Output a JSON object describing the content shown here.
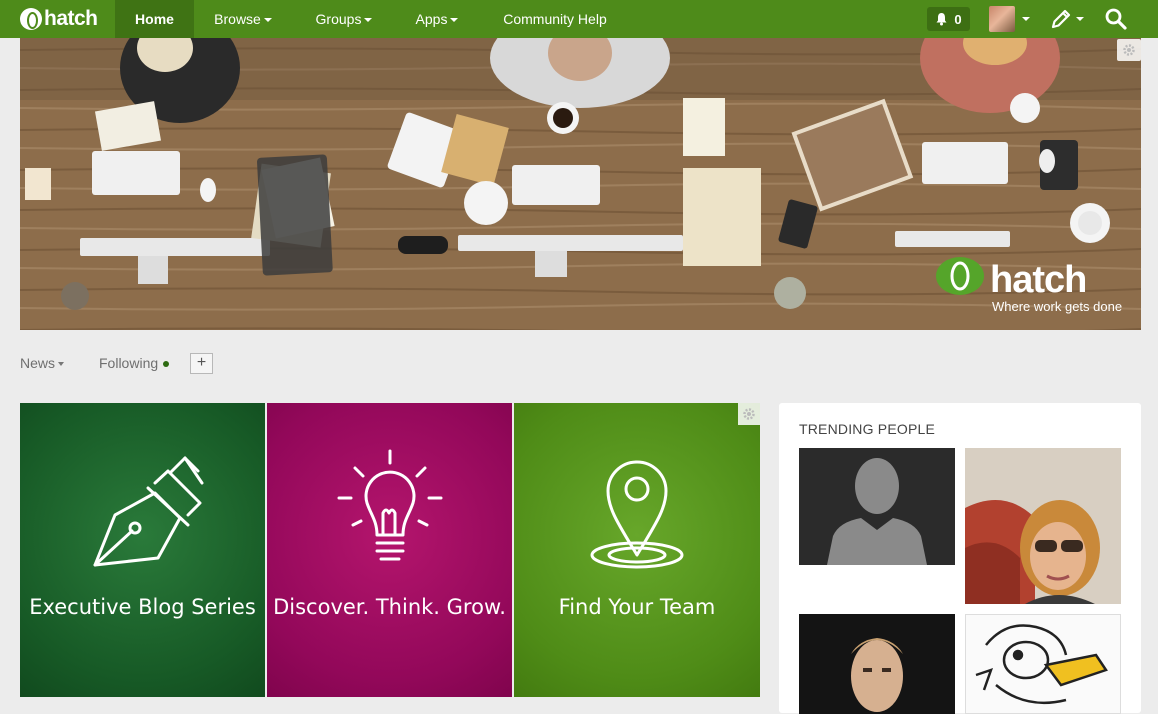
{
  "nav": {
    "logo_text": "hatch",
    "items": [
      {
        "label": "Home",
        "active": true
      },
      {
        "label": "Browse"
      },
      {
        "label": "Groups"
      },
      {
        "label": "Apps"
      },
      {
        "label": "Community Help"
      }
    ],
    "notification_count": "0",
    "icons": [
      "bell-icon",
      "avatar",
      "pencil-icon",
      "search-icon"
    ]
  },
  "banner": {
    "brand_word": "hatch",
    "brand_tagline": "Where work gets done"
  },
  "subtabs": {
    "news_label": "News",
    "following_label": "Following",
    "add_label": "+"
  },
  "tiles": [
    {
      "label": "Executive Blog Series",
      "icon": "fountain-pen-icon",
      "color": "#175a26"
    },
    {
      "label": "Discover. Think. Grow.",
      "icon": "lightbulb-icon",
      "color": "#93085a"
    },
    {
      "label": "Find Your Team",
      "icon": "map-pin-icon",
      "color": "#4f8c17"
    }
  ],
  "trending": {
    "title": "TRENDING PEOPLE"
  },
  "colors": {
    "nav_bg": "#4e8b1a",
    "nav_active": "#3f7314",
    "page_bg": "#ececec"
  }
}
